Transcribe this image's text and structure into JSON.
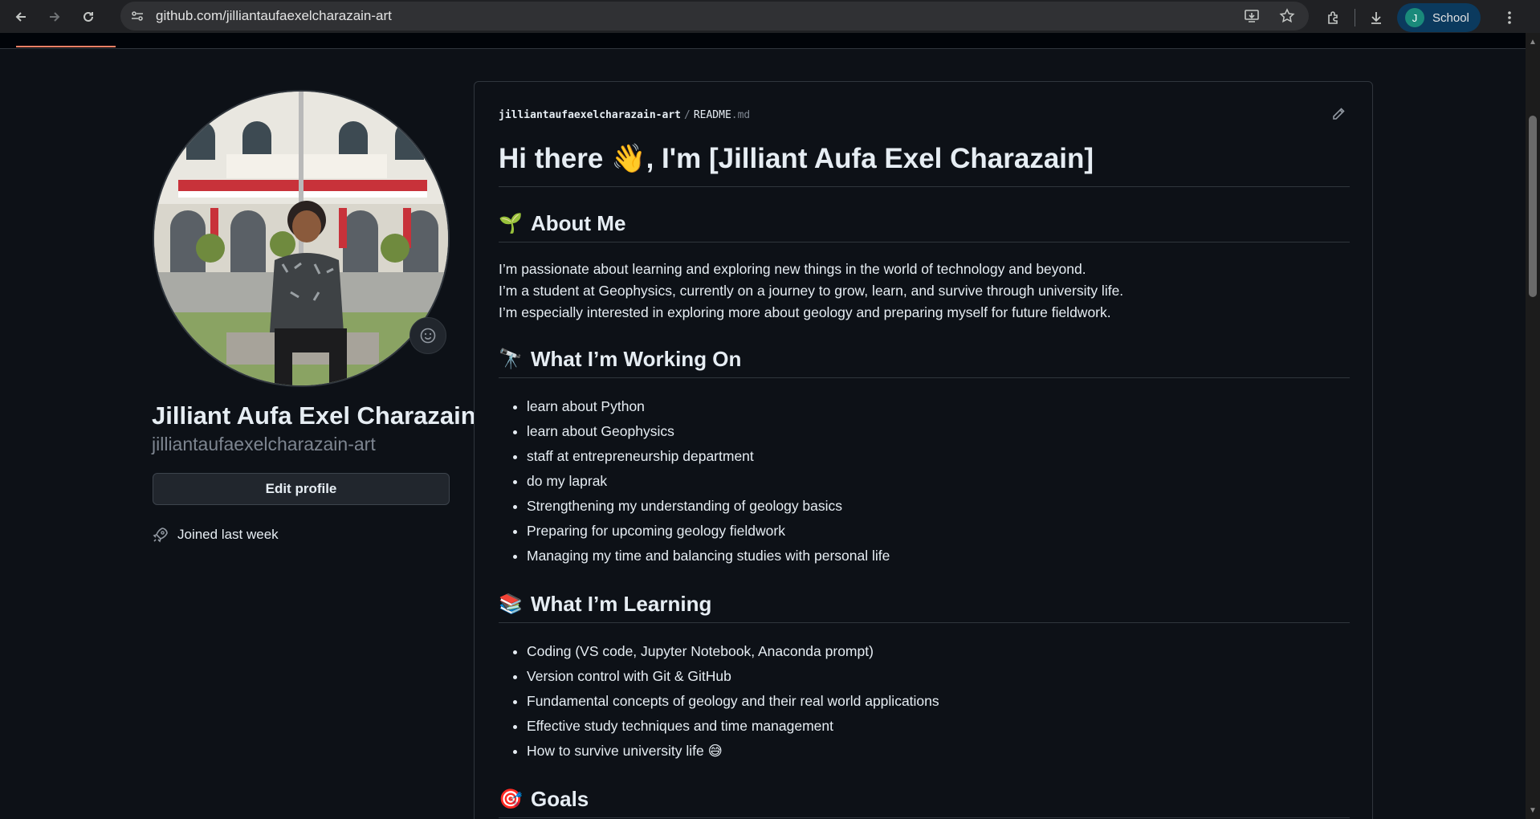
{
  "browser": {
    "url": "github.com/jilliantaufaexelcharazain-art",
    "profile_initial": "J",
    "profile_label": "School"
  },
  "profile": {
    "name": "Jilliant Aufa Exel Charazain",
    "login": "jilliantaufaexelcharazain-art",
    "edit_button": "Edit profile",
    "joined": "Joined last week"
  },
  "readme": {
    "path_owner": "jilliantaufaexelcharazain-art",
    "path_sep": "/",
    "path_file": "README",
    "path_ext": ".md",
    "title": "Hi there 👋, I'm [Jilliant Aufa Exel Charazain]",
    "about": {
      "emoji": "🌱",
      "heading": "About Me",
      "lines": [
        "I’m passionate about learning and exploring new things in the world of technology and beyond.",
        "I’m a student at Geophysics, currently on a journey to grow, learn, and survive through university life.",
        "I’m especially interested in exploring more about geology and preparing myself for future fieldwork."
      ]
    },
    "working": {
      "emoji": "🔭",
      "heading": "What I’m Working On",
      "items": [
        "learn about Python",
        "learn about Geophysics",
        "staff at entrepreneurship department",
        "do my laprak",
        "Strengthening my understanding of geology basics",
        "Preparing for upcoming geology fieldwork",
        "Managing my time and balancing studies with personal life"
      ]
    },
    "learning": {
      "emoji": "📚",
      "heading": "What I’m Learning",
      "items": [
        "Coding (VS code, Jupyter Notebook, Anaconda prompt)",
        "Version control with Git & GitHub",
        "Fundamental concepts of geology and their real world applications",
        "Effective study techniques and time management",
        "How to survive university life 😅"
      ]
    },
    "goals": {
      "emoji": "🎯",
      "heading": "Goals"
    }
  }
}
